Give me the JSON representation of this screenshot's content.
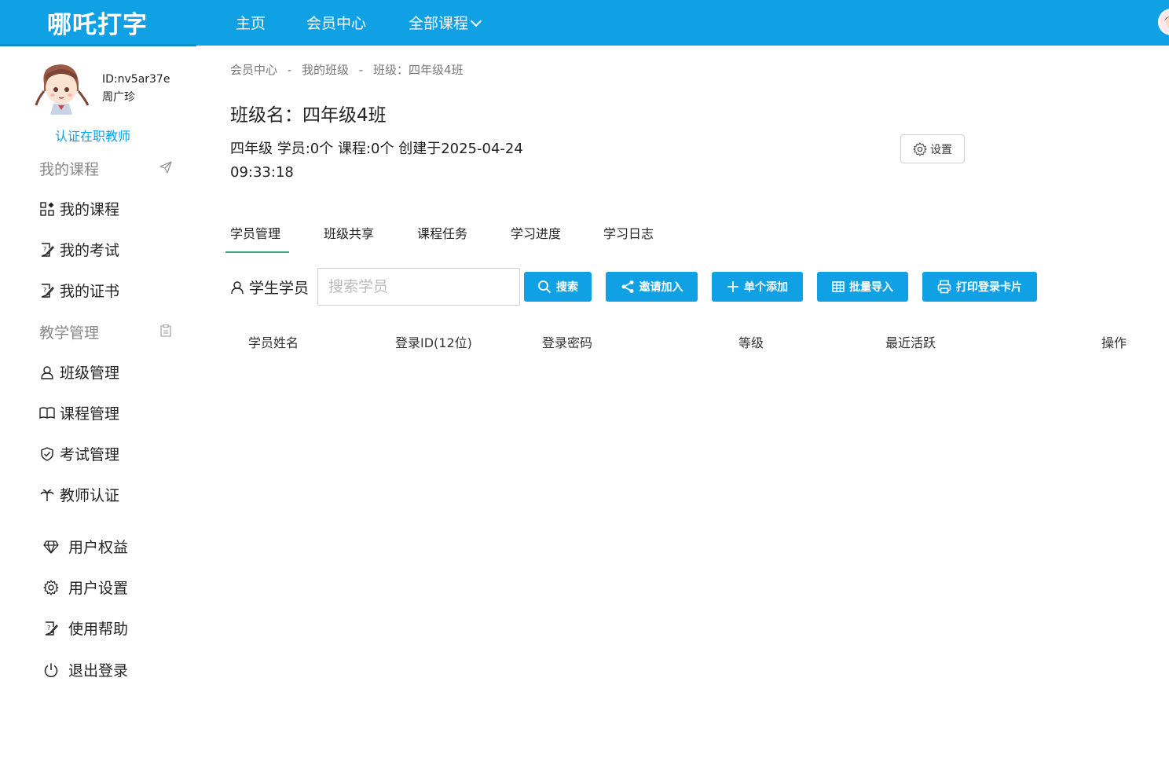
{
  "header": {
    "logo": "哪吒打字",
    "nav": [
      {
        "label": "主页"
      },
      {
        "label": "会员中心"
      },
      {
        "label": "全部课程"
      }
    ]
  },
  "sidebar": {
    "user_id": "ID:nv5ar37e",
    "user_name": "周广珍",
    "verify_link": "认证在职教师",
    "sections": [
      {
        "title": "我的课程",
        "icon": "send-icon"
      },
      {
        "title": "教学管理",
        "icon": "clipboard-icon"
      }
    ],
    "my_course_items": [
      {
        "label": "我的课程",
        "icon": "apps-icon"
      },
      {
        "label": "我的考试",
        "icon": "edit-doc-icon"
      },
      {
        "label": "我的证书",
        "icon": "certificate-icon"
      }
    ],
    "teaching_items": [
      {
        "label": "班级管理",
        "icon": "user-icon"
      },
      {
        "label": "课程管理",
        "icon": "book-icon"
      },
      {
        "label": "考试管理",
        "icon": "shield-check-icon"
      },
      {
        "label": "教师认证",
        "icon": "palm-icon"
      }
    ],
    "account_items": [
      {
        "label": "用户权益",
        "icon": "diamond-icon"
      },
      {
        "label": "用户设置",
        "icon": "gear-icon"
      },
      {
        "label": "使用帮助",
        "icon": "help-doc-icon"
      },
      {
        "label": "退出登录",
        "icon": "power-icon"
      }
    ]
  },
  "main": {
    "breadcrumb": [
      "会员中心",
      "-",
      "我的班级",
      "-",
      "班级：四年级4班"
    ],
    "class_title": "班级名：四年级4班",
    "class_meta": "四年级 学员:0个 课程:0个 创建于2025-04-24 09:33:18",
    "settings_label": "设置",
    "tabs": [
      {
        "label": "学员管理",
        "active": true
      },
      {
        "label": "班级共享"
      },
      {
        "label": "课程任务"
      },
      {
        "label": "学习进度"
      },
      {
        "label": "学习日志"
      }
    ],
    "student_label": "学生学员",
    "search_placeholder": "搜索学员",
    "buttons": {
      "search": "搜索",
      "invite": "邀请加入",
      "add_single": "单个添加",
      "batch_import": "批量导入",
      "print_cards": "打印登录卡片"
    },
    "table_headers": [
      "学员姓名",
      "登录ID(12位)",
      "登录密码",
      "等级",
      "最近活跃",
      "操作"
    ]
  },
  "colors": {
    "brand": "#10a1e4",
    "tab_underline": "#3aa57a"
  }
}
